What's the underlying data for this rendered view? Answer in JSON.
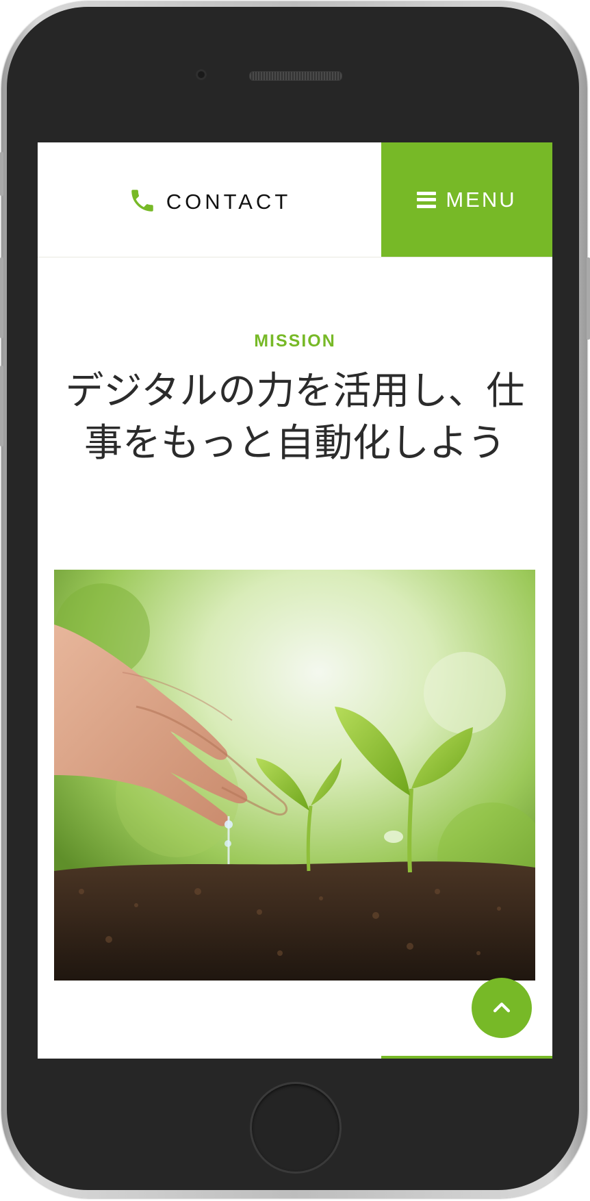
{
  "header": {
    "contact_label": "CONTACT",
    "menu_label": "MENU",
    "contact_icon": "phone-icon",
    "menu_icon": "hamburger-icon"
  },
  "mission": {
    "label": "MISSION",
    "headline_line1": "デジタルの力を活用し、仕",
    "headline_line2": "事をもっと自動化しよう"
  },
  "hero": {
    "image_name": "hands-watering-seedlings-photo"
  },
  "scroll_top": {
    "icon": "chevron-up-icon"
  },
  "colors": {
    "accent": "#77b927",
    "text": "#2b2b2b",
    "phone_body": "#262626"
  }
}
